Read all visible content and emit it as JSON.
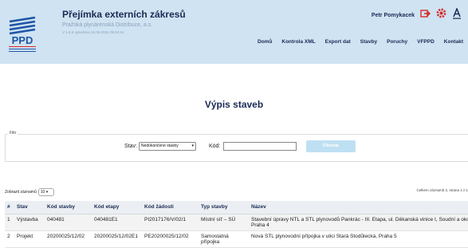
{
  "header": {
    "title": "Přejímka externích zákresů",
    "company": "Pražská plynárenská Distribuce, a.s.",
    "version": "V 1.6.5 vytvořeno 15.08.2021 09:10:24",
    "user_name": "Petr Pomykacek",
    "logo_text": "PPD",
    "logo_subtext": "PRAŽSKÁ PLYNÁRENSKÁ DISTRIBUCE, a.s.",
    "nav": [
      "Domů",
      "Kontrola XML",
      "Export dat",
      "Stavby",
      "Poruchy",
      "VFPPD",
      "Kontakt"
    ],
    "colors": {
      "header_bg": "#cfe3f2",
      "logo_blue": "#1e55a5",
      "accent_red": "#d72828"
    },
    "icons": [
      "logout-icon",
      "settings-icon",
      "accessibility-icon"
    ]
  },
  "page": {
    "title": "Výpis staveb"
  },
  "filter": {
    "legend": "Filtr",
    "stav_label": "Stav:",
    "stav_value": "Nedokončené stavby",
    "kod_label": "Kód:",
    "kod_value": "",
    "button_label": "Filtrovat"
  },
  "list_controls": {
    "show_label": "Zobrazit záznamů",
    "show_value": "10",
    "records_info": "Celkem záznamů 2, strana 1 z 1"
  },
  "table": {
    "columns": [
      "#",
      "Stav",
      "Kód stavby",
      "Kód etapy",
      "Kód žádosti",
      "Typ stavby",
      "Název"
    ],
    "rows": [
      [
        "1",
        "Výstavba",
        "040481",
        "040481E1",
        "PI2017176/V/02/1",
        "Místní síť – SÚ",
        "Stavební úpravy NTL a STL plynovodů Pankrác - III. Etapa, ul. Děkanská vinice I, Soudní a okolí, Praha 4"
      ],
      [
        "2",
        "Projekt",
        "20200025/12/02",
        "20200025/12/02E1",
        "PE20200025/12/02",
        "Samostatná přípojka",
        "Nová STL plynovodní přípojka v ulici Stará Stodůlecká, Praha 5"
      ]
    ]
  }
}
